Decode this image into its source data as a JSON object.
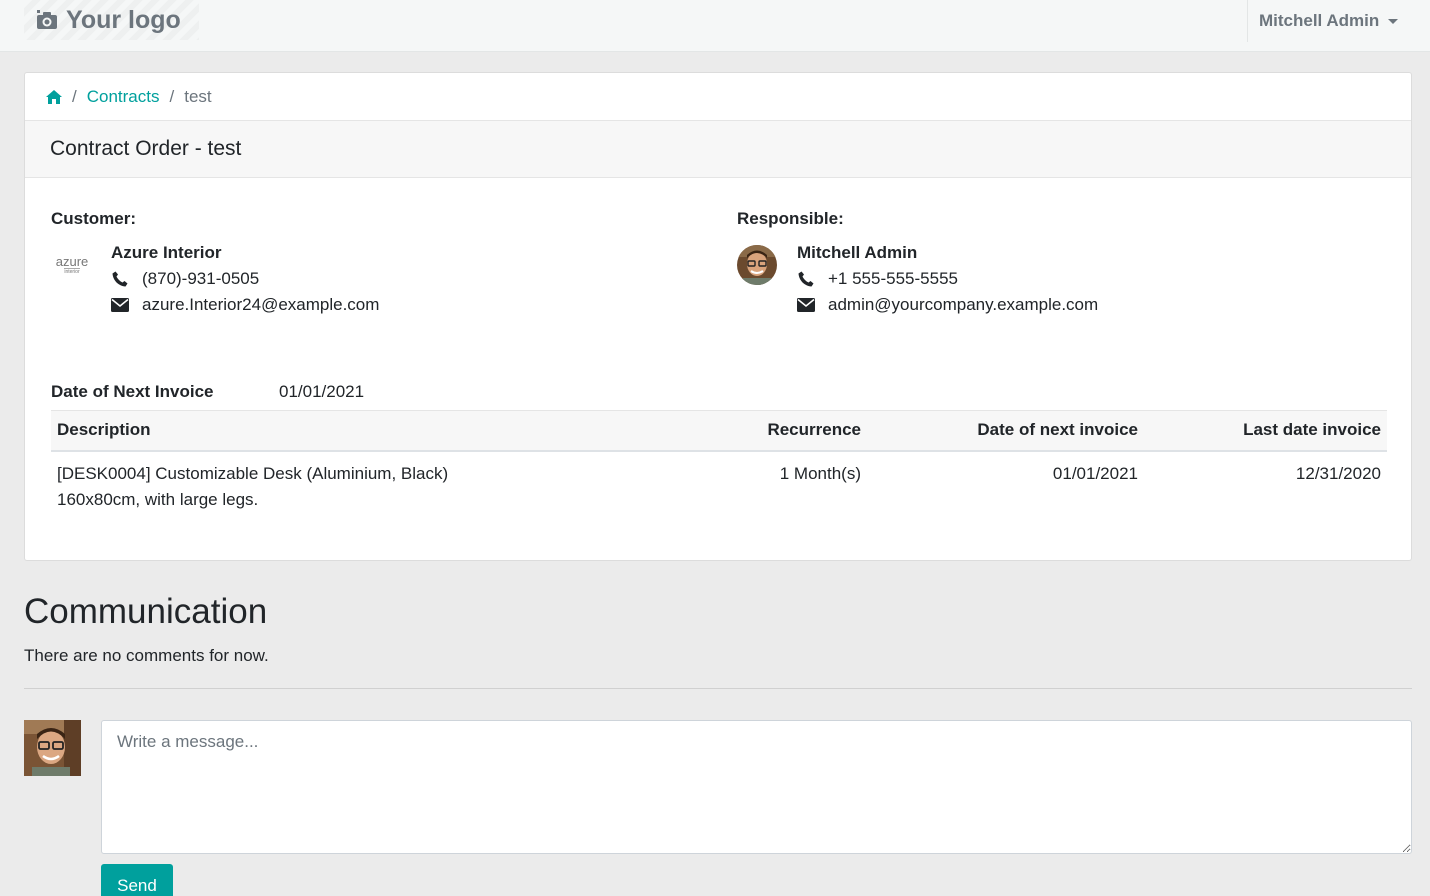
{
  "header": {
    "logo_text": "Your logo",
    "user_name": "Mitchell Admin"
  },
  "breadcrumb": {
    "home_icon": "home-icon",
    "contracts": "Contracts",
    "current": "test",
    "separator": "/"
  },
  "card": {
    "title": "Contract Order - test"
  },
  "customer": {
    "label": "Customer:",
    "logo_text": "azure",
    "logo_subtext": "interior",
    "name": "Azure Interior",
    "phone": "(870)-931-0505",
    "email": "azure.Interior24@example.com"
  },
  "responsible": {
    "label": "Responsible:",
    "name": "Mitchell Admin",
    "phone": "+1 555-555-5555",
    "email": "admin@yourcompany.example.com"
  },
  "next_invoice": {
    "label": "Date of Next Invoice",
    "value": "01/01/2021"
  },
  "lines": {
    "headers": [
      "Description",
      "Recurrence",
      "Date of next invoice",
      "Last date invoice"
    ],
    "rows": [
      {
        "description_line1": "[DESK0004] Customizable Desk (Aluminium, Black)",
        "description_line2": "160x80cm, with large legs.",
        "recurrence": "1 Month(s)",
        "next_invoice": "01/01/2021",
        "last_invoice": "12/31/2020"
      }
    ]
  },
  "communication": {
    "title": "Communication",
    "empty_text": "There are no comments for now.",
    "placeholder": "Write a message...",
    "send_label": "Send"
  },
  "colors": {
    "accent": "#00a09d",
    "background": "#ebebeb"
  }
}
